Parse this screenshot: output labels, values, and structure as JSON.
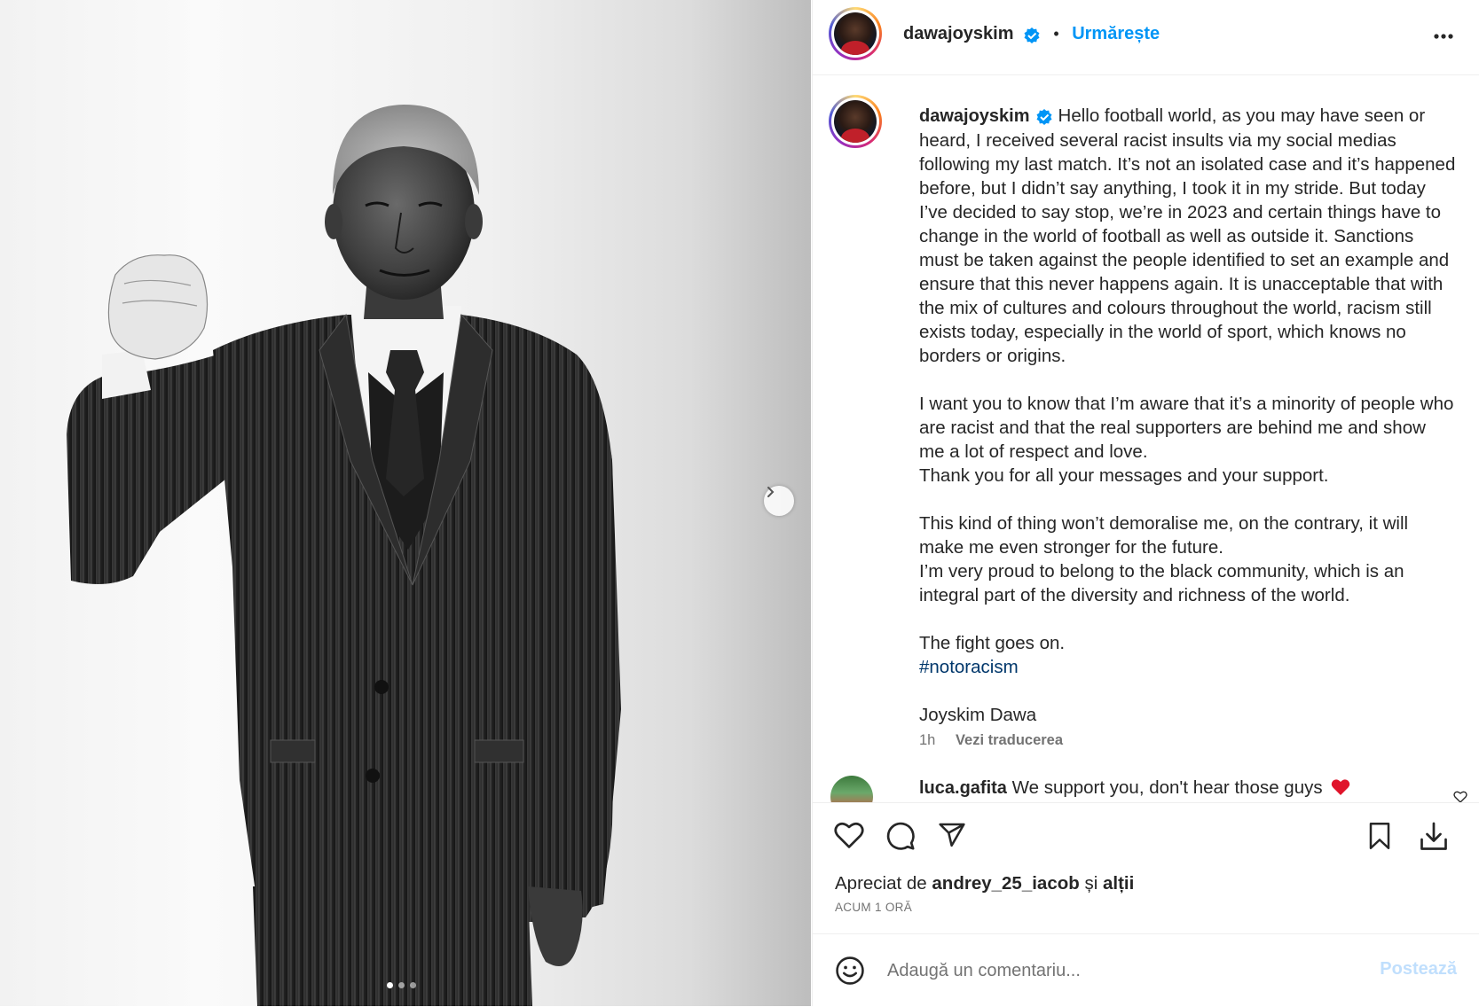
{
  "post": {
    "username": "dawajoyskim",
    "follow_label": "Urmărește",
    "bullet": "•",
    "verified_icon": "verified-badge-icon",
    "more_icon": "more-options-icon"
  },
  "media": {
    "slides_total": 3,
    "active_slide": 1,
    "next_icon": "chevron-right-icon"
  },
  "caption": {
    "username": "dawajoyskim",
    "paragraph1": "Hello football world, as you may have seen or heard, I received several racist insults via my social medias following my last match. It’s not an isolated case and it’s happened before, but I didn’t say anything, I took it in my stride. But today I’ve decided to say stop, we’re in 2023 and certain things have to change in the world of football as well as outside it. Sanctions must be taken against the people identified to set an example and ensure that this never happens again. It is unacceptable that with the mix of cultures and colours throughout the world, racism still exists today, especially in the world of sport, which knows no borders or origins.",
    "paragraph2": "I want you to know that I’m aware that it’s a minority of people who are racist and that the real supporters are behind me and show me a lot of respect and love.",
    "paragraph3": "Thank you for all your messages and your support.",
    "paragraph4": "This kind of thing won’t demoralise me, on the contrary, it will make me even stronger for the future.",
    "paragraph5": "I’m very proud to belong to the black community, which is an integral part of the diversity and richness of the world.",
    "paragraph6": "The fight goes on.",
    "hashtag": "#notoracism",
    "signature": "Joyskim Dawa",
    "time": "1h",
    "translate_label": "Vezi traducerea"
  },
  "comment": {
    "username": "luca.gafita",
    "text": "We support you, don't hear those guys"
  },
  "actions": {
    "like_icon": "heart-icon",
    "comment_icon": "comment-icon",
    "share_icon": "send-icon",
    "save_icon": "bookmark-icon",
    "download_icon": "download-icon"
  },
  "likes": {
    "prefix": "Apreciat de",
    "user": "andrey_25_iacob",
    "joiner": "și",
    "others": "alții"
  },
  "timestamp": "ACUM 1 ORĂ",
  "comment_box": {
    "placeholder": "Adaugă un comentariu...",
    "post_label": "Postează",
    "emoji_icon": "emoji-icon"
  },
  "colors": {
    "accent_blue": "#0095f6",
    "hashtag_blue": "#00376b",
    "muted_text": "#737373",
    "post_disabled": "#c0dffd",
    "heart_red": "#ed4956"
  }
}
